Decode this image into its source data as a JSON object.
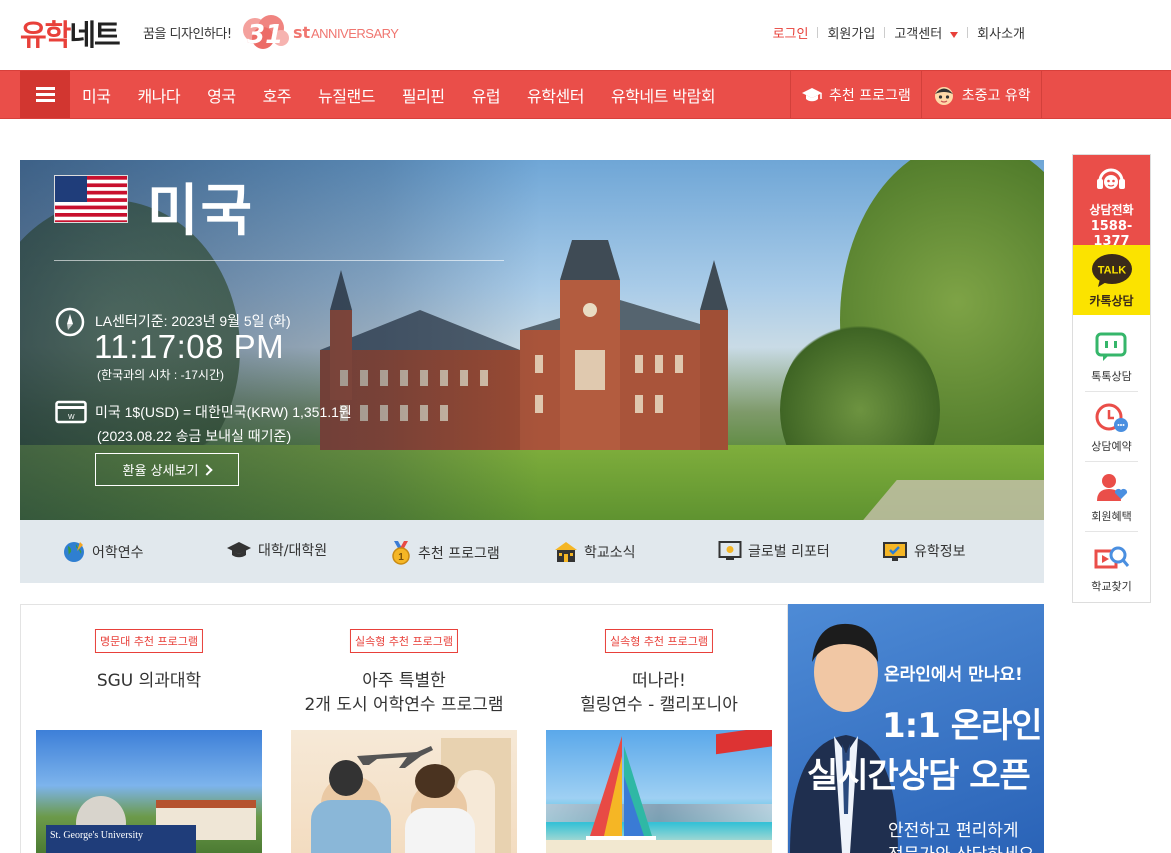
{
  "header": {
    "logo_red": "유학",
    "logo_black": "네트",
    "slogan": "꿈을 디자인하다!",
    "anniversary_number": "31",
    "anniversary_suffix": "st",
    "anniversary_word": "ANNIVERSARY",
    "links": [
      {
        "label": "로그인"
      },
      {
        "label": "회원가입"
      },
      {
        "label": "고객센터"
      },
      {
        "label": "회사소개"
      }
    ]
  },
  "nav": {
    "items": [
      "미국",
      "캐나다",
      "영국",
      "호주",
      "뉴질랜드",
      "필리핀",
      "유럽",
      "유학센터",
      "유학네트 박람회"
    ],
    "right": [
      {
        "label": "추천 프로그램",
        "icon": "graduation-cap-icon"
      },
      {
        "label": "초중고 유학",
        "icon": "student-face-icon"
      }
    ]
  },
  "hero": {
    "country": "미국",
    "time_basis": "LA센터기준: 2023년 9월 5일 (화)",
    "time": "11:17:08 PM",
    "time_diff": "(한국과의 시차 : -17시간)",
    "exchange_rate": "미국 1$(USD) = 대한민국(KRW) 1,351.1원",
    "exchange_note": "(2023.08.22 송금 보내실 때기준)",
    "exchange_button": "환율 상세보기"
  },
  "categories": [
    {
      "label": "어학연수",
      "icon": "globe-icon"
    },
    {
      "label": "대학/대학원",
      "icon": "graduation-cap-icon"
    },
    {
      "label": "추천 프로그램",
      "icon": "medal-icon"
    },
    {
      "label": "학교소식",
      "icon": "school-icon"
    },
    {
      "label": "글로벌 리포터",
      "icon": "monitor-icon"
    },
    {
      "label": "유학정보",
      "icon": "info-board-icon"
    }
  ],
  "quick_menu": {
    "call_label": "상담전화",
    "call_number": "1588-1377",
    "talk_badge": "TALK",
    "talk_label": "카톡상담",
    "items": [
      {
        "label": "톡톡상담",
        "icon": "chat-bubble-icon"
      },
      {
        "label": "상담예약",
        "icon": "alarm-clock-icon"
      },
      {
        "label": "회원혜택",
        "icon": "member-heart-icon"
      },
      {
        "label": "학교찾기",
        "icon": "search-school-icon"
      }
    ]
  },
  "programs": [
    {
      "tag": "명문대 추천 프로그램",
      "title_line1": "SGU 의과대학",
      "title_line2": "",
      "thumb_text": "St. George's University"
    },
    {
      "tag": "실속형 추천 프로그램",
      "title_line1": "아주 특별한",
      "title_line2": "2개 도시 어학연수 프로그램"
    },
    {
      "tag": "실속형 추천 프로그램",
      "title_line1": "떠나라!",
      "title_line2": "힐링연수 - 캘리포니아"
    }
  ],
  "banner": {
    "line1": "온라인에서 만나요!",
    "line2": "1:1 온라인",
    "line3": "실시간상담 오픈",
    "line4": "안전하고 편리하게",
    "line5": "전문가와 상담하세요"
  },
  "colors": {
    "brand_red": "#ea4e49",
    "kakao_yellow": "#fbe300",
    "category_bg": "#e1e8ed",
    "banner_blue": "#3a76c9"
  }
}
